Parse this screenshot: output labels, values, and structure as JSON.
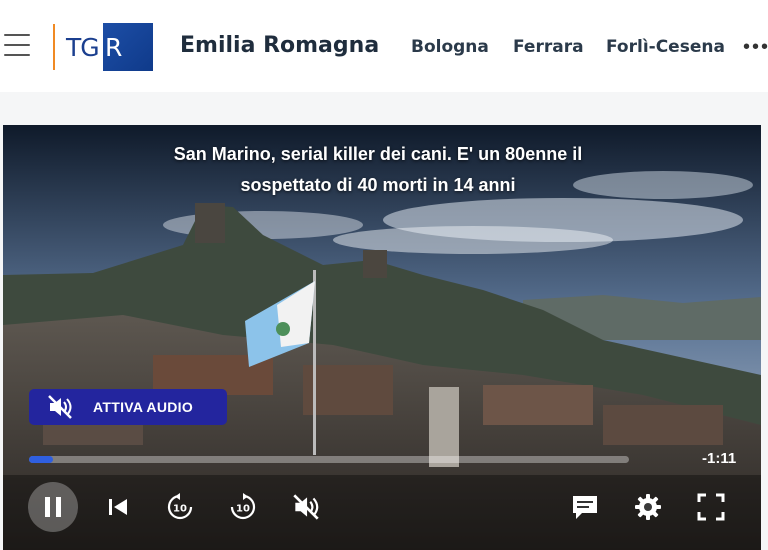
{
  "header": {
    "logo_text_left": "TG",
    "logo_text_right": "R",
    "region": "Emilia Romagna",
    "nav": [
      "Bologna",
      "Ferrara",
      "Forlì-Cesena"
    ],
    "more": "•••"
  },
  "player": {
    "title": "San Marino, serial killer dei cani. E' un 80enne il sospettato di 40 morti in 14 anni",
    "audio_button": "ATTIVA AUDIO",
    "time_remaining": "-1:11",
    "progress_fraction": 0.04
  },
  "icons": {
    "menu": "hamburger-icon",
    "mute": "volume-off-icon",
    "pause": "pause-icon",
    "previous": "skip-previous-icon",
    "rewind": "replay-10-icon",
    "forward": "forward-10-icon",
    "subtitles": "subtitles-icon",
    "settings": "gear-icon",
    "fullscreen": "fullscreen-icon"
  },
  "colors": {
    "accent": "#23259e",
    "progress": "#2f5fe0",
    "logo_bar": "#f08a24"
  }
}
